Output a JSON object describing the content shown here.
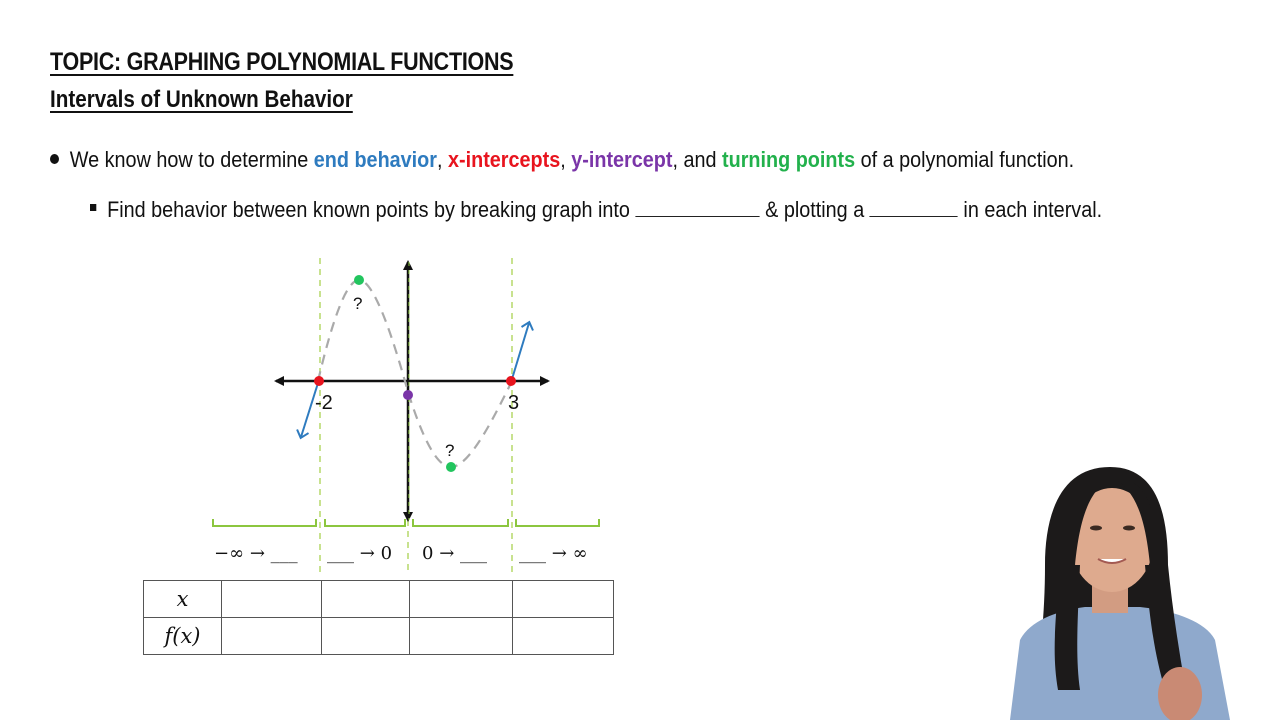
{
  "header": {
    "topic": "TOPIC: GRAPHING POLYNOMIAL FUNCTIONS",
    "subtitle": "Intervals of Unknown Behavior"
  },
  "bullets": {
    "main": {
      "prefix": "We know how to determine ",
      "end_behavior": "end behavior",
      "sep1": ", ",
      "x_intercepts": "x-intercepts",
      "sep2": ", ",
      "y_intercept": "y-intercept",
      "sep3": ", and ",
      "turning_points": "turning points",
      "suffix": " of a polynomial function."
    },
    "sub": {
      "part1": "Find behavior between known points by breaking graph into ",
      "part2": " & plotting a ",
      "part3": " in each interval."
    }
  },
  "colors": {
    "end_behavior": "#2e7bbf",
    "x_intercepts": "#e8141e",
    "y_intercept": "#7a35a8",
    "turning_points": "#22b14c",
    "interval_guides": "#8cc63f",
    "curve": "#aaaaaa"
  },
  "graph": {
    "x_intercept_labels": [
      "-2",
      "3"
    ],
    "turning_point_labels": [
      "?",
      "?"
    ],
    "intervals": [
      {
        "from": "−∞",
        "arrow": "→",
        "to": "___"
      },
      {
        "from": "___",
        "arrow": "→",
        "to": "0"
      },
      {
        "from": "0",
        "arrow": "→",
        "to": "___"
      },
      {
        "from": "___",
        "arrow": "→",
        "to": "∞"
      }
    ]
  },
  "table": {
    "row_headers": [
      "x",
      "f(x)"
    ],
    "columns": 4,
    "cells": [
      [
        "",
        "",
        "",
        ""
      ],
      [
        "",
        "",
        "",
        ""
      ]
    ]
  }
}
